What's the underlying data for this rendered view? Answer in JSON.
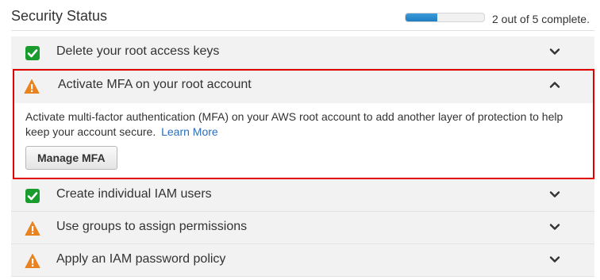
{
  "header": {
    "title": "Security Status",
    "progress_text": "2 out of 5 complete.",
    "progress_fraction": 0.4
  },
  "colors": {
    "complete": "#1a9b2e",
    "warning": "#e8831f",
    "highlight_border": "#e00000",
    "link": "#2a6ebb",
    "progress_fill": "#2a8ad0"
  },
  "items": [
    {
      "label": "Delete your root access keys",
      "status": "complete",
      "icon": "check-icon",
      "expanded": false
    },
    {
      "label": "Activate MFA on your root account",
      "status": "warning",
      "icon": "warning-icon",
      "expanded": true,
      "description": "Activate multi-factor authentication (MFA) on your AWS root account to add another layer of protection to help keep your account secure.",
      "link_text": "Learn More",
      "button_label": "Manage MFA"
    },
    {
      "label": "Create individual IAM users",
      "status": "complete",
      "icon": "check-icon",
      "expanded": false
    },
    {
      "label": "Use groups to assign permissions",
      "status": "warning",
      "icon": "warning-icon",
      "expanded": false
    },
    {
      "label": "Apply an IAM password policy",
      "status": "warning",
      "icon": "warning-icon",
      "expanded": false
    }
  ]
}
